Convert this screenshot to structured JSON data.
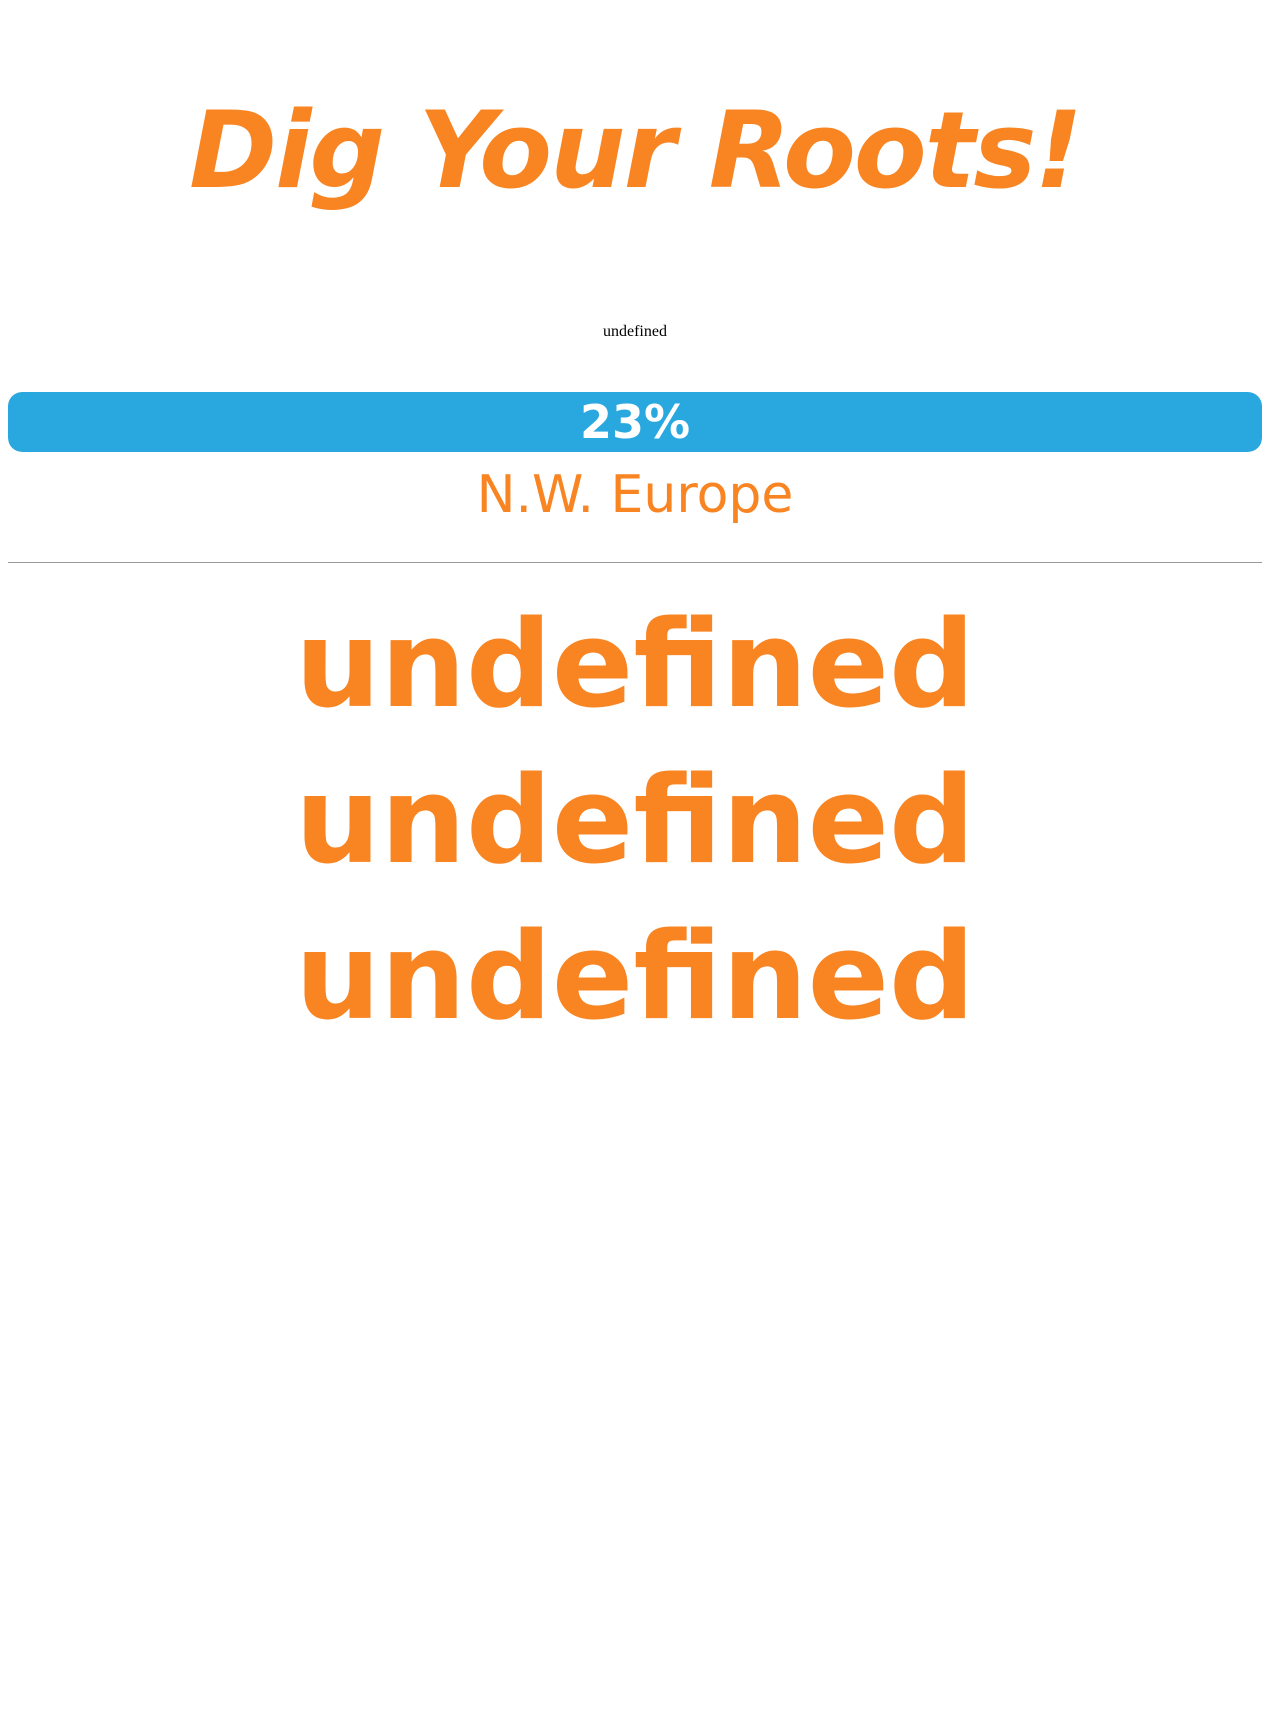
{
  "page": {
    "title": "Dig Your Roots!",
    "subtitle": "undefined"
  },
  "progress": {
    "label": "23%",
    "value_percent": 23,
    "fill_color": "#29a8e0"
  },
  "region": "N.W. Europe",
  "results": [
    "undefined",
    "undefined",
    "undefined"
  ],
  "colors": {
    "accent": "#f98422",
    "progress": "#29a8e0"
  }
}
